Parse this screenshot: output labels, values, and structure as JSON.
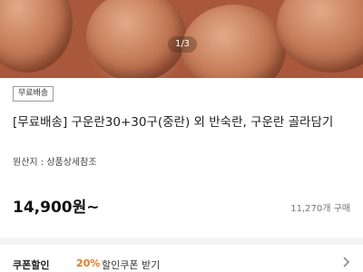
{
  "hero": {
    "pager": "1/3"
  },
  "product": {
    "badge": "무료배송",
    "title": "[무료배송] 구운란30+30구(중란) 외 반숙란, 구운란 골라담기",
    "origin": "원산지 : 상품상세참조",
    "price": "14,900원~",
    "sold": "11,270개 구매"
  },
  "coupon": {
    "label": "쿠폰할인",
    "rate": "20%",
    "text": "할인쿠폰 받기",
    "chevron_icon": "chevron-right-icon"
  },
  "colors": {
    "accent": "#f2761b",
    "divider": "#f4f4f4"
  }
}
